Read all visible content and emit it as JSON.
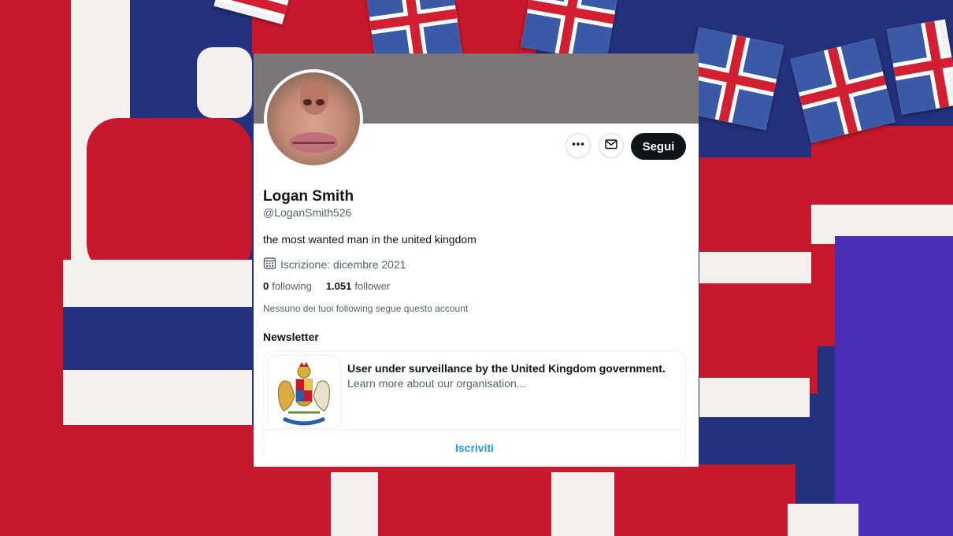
{
  "profile": {
    "name": "Logan Smith",
    "handle": "@LoganSmith526",
    "bio": "the most wanted man in the united kingdom",
    "joined": "Iscrizione: dicembre 2021",
    "following_count": "0",
    "following_label": "following",
    "followers_count": "1.051",
    "followers_label": "follower",
    "mutuals_note": "Nessuno dei tuoi following segue questo account"
  },
  "actions": {
    "more_icon": "more-icon",
    "message_icon": "mail-icon",
    "follow_label": "Segui",
    "follow_color": "#0f1419"
  },
  "newsletter": {
    "heading": "Newsletter",
    "title": "User under surveillance by the United Kingdom government.",
    "description": "Learn more about our organisation...",
    "subscribe_label": "Iscriviti",
    "subscribe_color": "#1d9bf0",
    "logo_icon": "royal-coat-of-arms"
  },
  "colors": {
    "banner": "#7c7677",
    "text_primary": "#0f1419",
    "text_secondary": "#536471"
  }
}
